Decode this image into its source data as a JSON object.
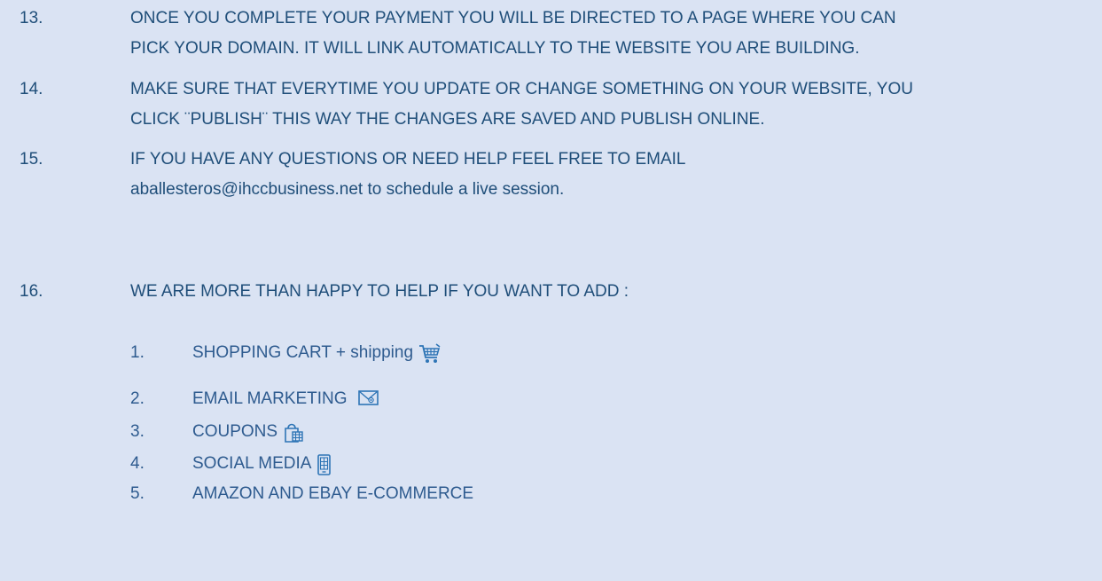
{
  "items": [
    {
      "number": "13.",
      "line1": "ONCE YOU COMPLETE YOUR PAYMENT YOU WILL BE DIRECTED TO A PAGE WHERE YOU CAN",
      "line2": "PICK YOUR DOMAIN. IT WILL LINK AUTOMATICALLY TO THE WEBSITE YOU ARE BUILDING."
    },
    {
      "number": "14.",
      "line1": "MAKE SURE THAT EVERYTIME YOU UPDATE OR CHANGE SOMETHING ON YOUR WEBSITE, YOU",
      "line2": "CLICK ¨PUBLISH¨ THIS WAY THE CHANGES ARE SAVED AND PUBLISH ONLINE."
    },
    {
      "number": "15.",
      "line1": "IF YOU HAVE ANY QUESTIONS OR NEED HELP FEEL FREE TO EMAIL",
      "line2": "aballesteros@ihccbusiness.net to schedule a live session."
    },
    {
      "number": "16.",
      "line1": "WE ARE MORE THAN HAPPY TO HELP IF YOU WANT TO ADD :"
    }
  ],
  "sub_items": [
    {
      "number": "1.",
      "label": "SHOPPING CART + shipping",
      "icon": "shopping-cart-icon"
    },
    {
      "number": "2.",
      "label": "EMAIL MARKETING",
      "icon": "email-icon"
    },
    {
      "number": "3.",
      "label": "COUPONS",
      "icon": "shopping-bag-icon"
    },
    {
      "number": "4.",
      "label": "SOCIAL MEDIA",
      "icon": "mobile-phone-icon"
    },
    {
      "number": "5.",
      "label": "AMAZON AND EBAY E-COMMERCE",
      "icon": ""
    }
  ],
  "colors": {
    "background": "#dae3f3",
    "text": "#1f4e79",
    "icon": "#2e75b6"
  }
}
